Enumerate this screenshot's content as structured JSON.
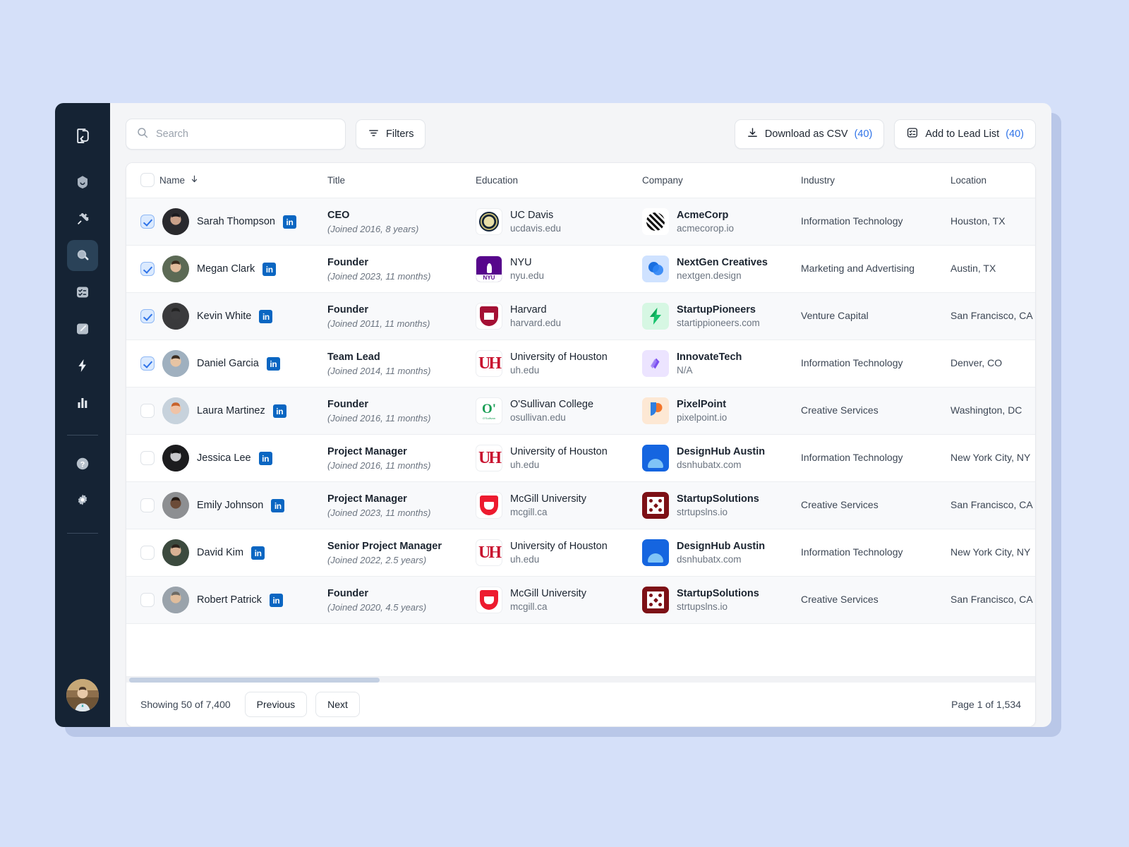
{
  "colors": {
    "page_background": "#d5e0f9",
    "sidebar": "#152334",
    "accent_blue": "#2f73e8",
    "linkedin_blue": "#0a66c2",
    "row_alt": "#f8f9fb"
  },
  "sidebar": {
    "items": [
      {
        "name": "logo",
        "icon": "document-sync-icon",
        "active": false
      },
      {
        "name": "home",
        "icon": "home-icon",
        "active": false
      },
      {
        "name": "magic",
        "icon": "magic-wand-icon",
        "active": false
      },
      {
        "name": "search",
        "icon": "search-icon",
        "active": true
      },
      {
        "name": "tasks",
        "icon": "checklist-icon",
        "active": false
      },
      {
        "name": "compose",
        "icon": "pencil-icon",
        "active": false
      },
      {
        "name": "automations",
        "icon": "lightning-bolt-icon",
        "active": false
      },
      {
        "name": "analytics",
        "icon": "bar-chart-icon",
        "active": false
      }
    ],
    "utility": [
      {
        "name": "help",
        "icon": "question-mark-icon"
      },
      {
        "name": "settings",
        "icon": "gear-icon"
      }
    ],
    "avatar": {
      "name": "user-avatar",
      "alt": "Account avatar"
    }
  },
  "toolbar": {
    "search": {
      "value": "",
      "placeholder": "Search",
      "icon": "search-icon"
    },
    "filters_label": "Filters",
    "filters_icon": "filter-icon",
    "download_label": "Download as CSV",
    "download_count": "(40)",
    "download_icon": "download-icon",
    "add_label": "Add to Lead List",
    "add_count": "(40)",
    "add_icon": "list-add-icon"
  },
  "table": {
    "columns": [
      {
        "key": "name",
        "label": "Name",
        "sort_icon": "arrow-down-icon",
        "sorted": true
      },
      {
        "key": "title",
        "label": "Title"
      },
      {
        "key": "education",
        "label": "Education"
      },
      {
        "key": "company",
        "label": "Company"
      },
      {
        "key": "industry",
        "label": "Industry"
      },
      {
        "key": "location",
        "label": "Location"
      }
    ],
    "header_checkbox_checked": false,
    "rows": [
      {
        "checked": true,
        "name": "Sarah Thompson",
        "linkedin": "in",
        "title": "CEO",
        "tenure": "(Joined 2016, 8 years)",
        "school": "UC Davis",
        "school_domain": "ucdavis.edu",
        "school_logo": "ucdavis-logo",
        "company": "AcmeCorp",
        "company_domain": "acmecorop.io",
        "company_logo": "acmecorp-logo",
        "industry": "Information Technology",
        "location": "Houston, TX"
      },
      {
        "checked": true,
        "name": "Megan Clark",
        "linkedin": "in",
        "title": "Founder",
        "tenure": "(Joined 2023, 11 months)",
        "school": "NYU",
        "school_domain": "nyu.edu",
        "school_logo": "nyu-logo",
        "company": "NextGen Creatives",
        "company_domain": "nextgen.design",
        "company_logo": "nextgen-logo",
        "industry": "Marketing and Advertising",
        "location": "Austin, TX"
      },
      {
        "checked": true,
        "name": "Kevin White",
        "linkedin": "in",
        "title": "Founder",
        "tenure": "(Joined 2011, 11 months)",
        "school": "Harvard",
        "school_domain": "harvard.edu",
        "school_logo": "harvard-logo",
        "company": "StartupPioneers",
        "company_domain": "startippioneers.com",
        "company_logo": "startuppioneers-logo",
        "industry": "Venture Capital",
        "location": "San Francisco, CA"
      },
      {
        "checked": true,
        "name": "Daniel Garcia",
        "linkedin": "in",
        "title": "Team Lead",
        "tenure": "(Joined 2014, 11 months)",
        "school": "University of Houston",
        "school_domain": "uh.edu",
        "school_logo": "houston-logo",
        "company": "InnovateTech",
        "company_domain": "N/A",
        "company_logo": "innovatetech-logo",
        "industry": "Information Technology",
        "location": "Denver, CO"
      },
      {
        "checked": false,
        "name": "Laura Martinez",
        "linkedin": "in",
        "title": "Founder",
        "tenure": "(Joined 2016, 11 months)",
        "school": "O'Sullivan College",
        "school_domain": "osullivan.edu",
        "school_logo": "osullivan-logo",
        "company": "PixelPoint",
        "company_domain": "pixelpoint.io",
        "company_logo": "pixelpoint-logo",
        "industry": "Creative Services",
        "location": "Washington, DC"
      },
      {
        "checked": false,
        "name": "Jessica Lee",
        "linkedin": "in",
        "title": "Project Manager",
        "tenure": "(Joined 2016, 11 months)",
        "school": "University of Houston",
        "school_domain": "uh.edu",
        "school_logo": "houston-logo",
        "company": "DesignHub Austin",
        "company_domain": "dsnhubatx.com",
        "company_logo": "designhub-logo",
        "industry": "Information Technology",
        "location": "New York City, NY"
      },
      {
        "checked": false,
        "name": "Emily Johnson",
        "linkedin": "in",
        "title": "Project Manager",
        "tenure": "(Joined 2023, 11 months)",
        "school": "McGill University",
        "school_domain": "mcgill.ca",
        "school_logo": "mcgill-logo",
        "company": "StartupSolutions",
        "company_domain": "strtupslns.io",
        "company_logo": "startupsolutions-logo",
        "industry": "Creative Services",
        "location": "San Francisco, CA"
      },
      {
        "checked": false,
        "name": "David Kim",
        "linkedin": "in",
        "title": "Senior Project Manager",
        "tenure": "(Joined 2022, 2.5 years)",
        "school": "University of Houston",
        "school_domain": "uh.edu",
        "school_logo": "houston-logo",
        "company": "DesignHub Austin",
        "company_domain": "dsnhubatx.com",
        "company_logo": "designhub-logo",
        "industry": "Information Technology",
        "location": "New York City, NY"
      },
      {
        "checked": false,
        "name": "Robert Patrick",
        "linkedin": "in",
        "title": "Founder",
        "tenure": "(Joined 2020, 4.5 years)",
        "school": "McGill University",
        "school_domain": "mcgill.ca",
        "school_logo": "mcgill-logo",
        "company": "StartupSolutions",
        "company_domain": "strtupslns.io",
        "company_logo": "startupsolutions-logo",
        "industry": "Creative Services",
        "location": "San Francisco, CA"
      }
    ]
  },
  "footer": {
    "showing": "Showing 50 of 7,400",
    "previous_label": "Previous",
    "next_label": "Next",
    "page_info": "Page 1 of 1,534"
  }
}
